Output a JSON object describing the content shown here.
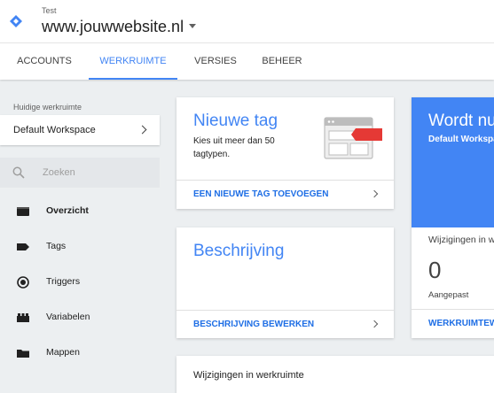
{
  "header": {
    "account": "Test",
    "container": "www.jouwwebsite.nl"
  },
  "tabs": [
    {
      "label": "ACCOUNTS",
      "active": false
    },
    {
      "label": "WERKRUIMTE",
      "active": true
    },
    {
      "label": "VERSIES",
      "active": false
    },
    {
      "label": "BEHEER",
      "active": false
    }
  ],
  "sidebar": {
    "workspace_label": "Huidige werkruimte",
    "workspace_name": "Default Workspace",
    "search_placeholder": "Zoeken",
    "items": [
      {
        "label": "Overzicht",
        "icon": "overview-icon",
        "active": true
      },
      {
        "label": "Tags",
        "icon": "tag-icon",
        "active": false
      },
      {
        "label": "Triggers",
        "icon": "trigger-icon",
        "active": false
      },
      {
        "label": "Variabelen",
        "icon": "variable-icon",
        "active": false
      },
      {
        "label": "Mappen",
        "icon": "folder-icon",
        "active": false
      }
    ]
  },
  "cards": {
    "new_tag": {
      "title": "Nieuwe tag",
      "description": "Kies uit meer dan 50 tagtypen.",
      "link": "EEN NIEUWE TAG TOEVOEGEN"
    },
    "description": {
      "title": "Beschrijving",
      "link": "BESCHRIJVING BEWERKEN"
    },
    "publish": {
      "title": "Wordt nu",
      "subtitle": "Default Workspace",
      "changes_label": "Wijzigingen in werkruimte",
      "changes_count": "0",
      "changes_sub": "Aangepast",
      "link": "WERKRUIMTEWIJZIGINGEN"
    },
    "workspace_changes": {
      "title": "Wijzigingen in werkruimte"
    }
  },
  "colors": {
    "accent": "#4285f4",
    "link": "#1e6ee5",
    "background": "#eceff1",
    "tag_red": "#e53935"
  }
}
